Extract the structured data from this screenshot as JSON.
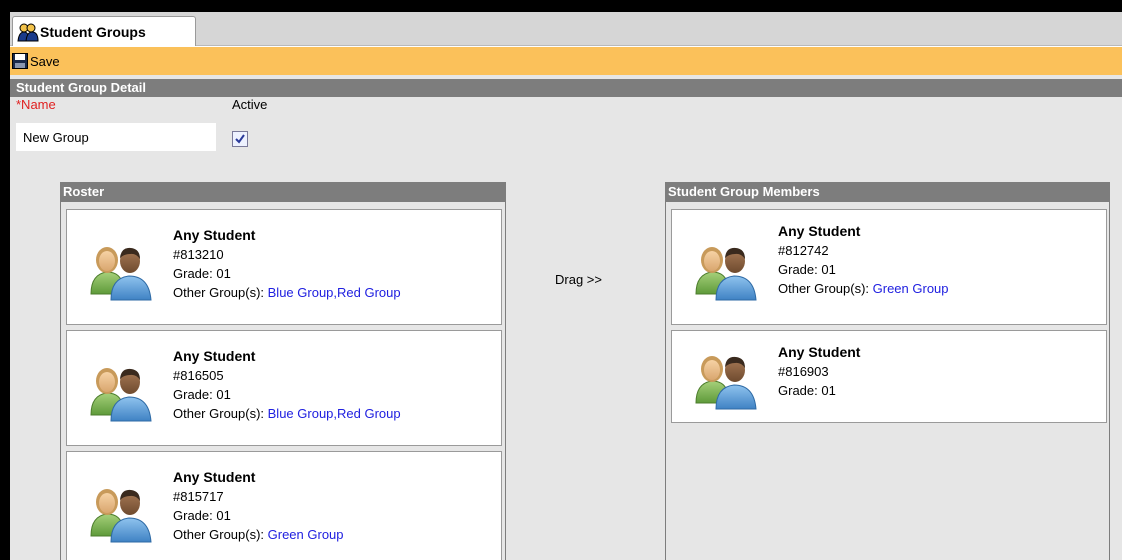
{
  "tab": {
    "label": "Student Groups",
    "icon": "students-icon"
  },
  "toolbar": {
    "save_label": "Save",
    "save_icon": "floppy-disk-icon"
  },
  "detail": {
    "header": "Student Group Detail",
    "name_label": "*Name",
    "active_label": "Active",
    "name_value": "New Group",
    "active_checked": true
  },
  "roster": {
    "header": "Roster",
    "students": [
      {
        "name": "Any Student",
        "id": "#813210",
        "grade": "Grade: 01",
        "groups_label": "Other Group(s): ",
        "groups": "Blue Group,Red Group"
      },
      {
        "name": "Any Student",
        "id": "#816505",
        "grade": "Grade: 01",
        "groups_label": "Other Group(s): ",
        "groups": "Blue Group,Red Group"
      },
      {
        "name": "Any Student",
        "id": "#815717",
        "grade": "Grade: 01",
        "groups_label": "Other Group(s): ",
        "groups": "Green Group"
      }
    ]
  },
  "drag_label": "Drag >>",
  "members": {
    "header": "Student Group Members",
    "students": [
      {
        "name": "Any Student",
        "id": "#812742",
        "grade": "Grade: 01",
        "groups_label": "Other Group(s): ",
        "groups": "Green Group"
      },
      {
        "name": "Any Student",
        "id": "#816903",
        "grade": "Grade: 01"
      }
    ]
  },
  "colors": {
    "toolbar": "#fbc15a",
    "header": "#7d7d7d",
    "required": "#e02020",
    "link": "#2020e0",
    "background": "#e6e6e6"
  }
}
